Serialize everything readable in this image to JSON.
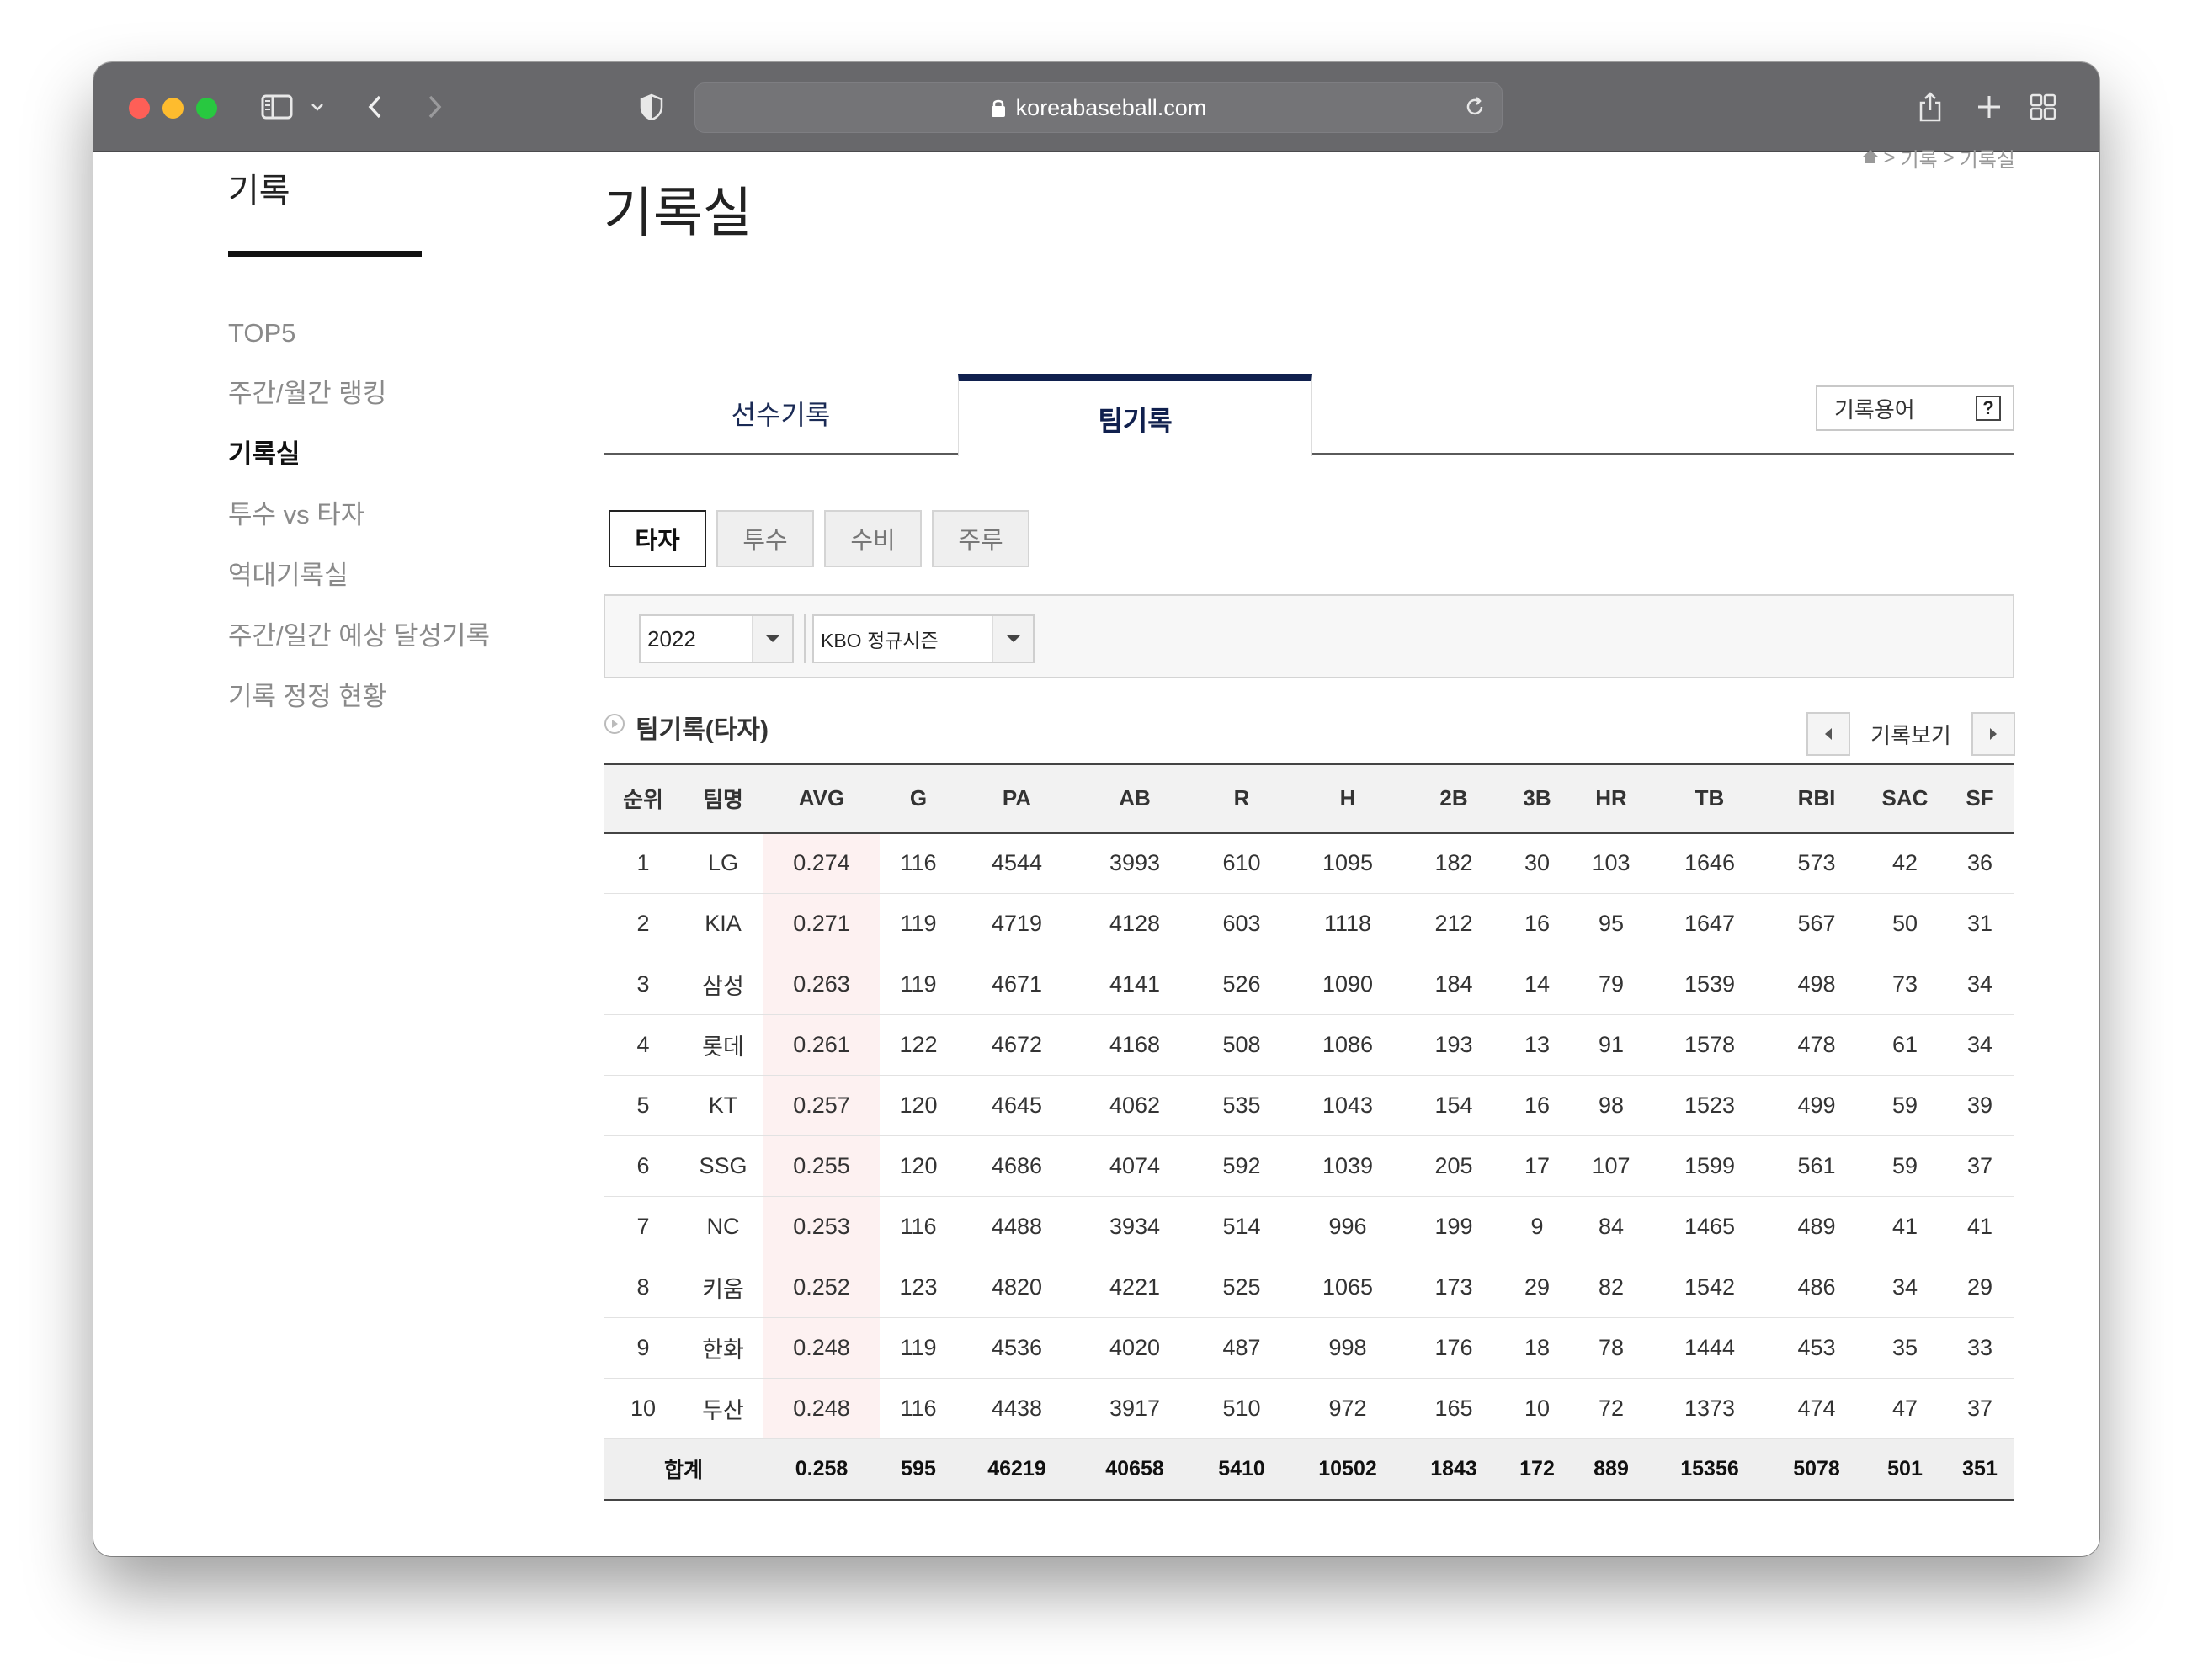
{
  "browser": {
    "url": "koreabaseball.com"
  },
  "sidebar": {
    "title": "기록",
    "items": [
      {
        "label": "TOP5",
        "active": false
      },
      {
        "label": "주간/월간 랭킹",
        "active": false
      },
      {
        "label": "기록실",
        "active": true
      },
      {
        "label": "투수 vs 타자",
        "active": false
      },
      {
        "label": "역대기록실",
        "active": false
      },
      {
        "label": "주간/일간 예상 달성기록",
        "active": false
      },
      {
        "label": "기록 정정 현황",
        "active": false
      }
    ]
  },
  "breadcrumb": {
    "items": [
      "기록",
      "기록실"
    ],
    "sep": ">"
  },
  "main": {
    "title": "기록실",
    "tabs": [
      {
        "label": "선수기록",
        "active": false
      },
      {
        "label": "팀기록",
        "active": true
      }
    ],
    "term_button": {
      "label": "기록용어",
      "q": "?"
    },
    "subtabs": [
      {
        "label": "타자",
        "active": true
      },
      {
        "label": "투수",
        "active": false
      },
      {
        "label": "수비",
        "active": false
      },
      {
        "label": "주루",
        "active": false
      }
    ],
    "filters": {
      "year": "2022",
      "season": "KBO 정규시즌"
    },
    "section_title": "팀기록(타자)",
    "nav_label": "기록보기"
  },
  "table": {
    "headers": [
      "순위",
      "팀명",
      "AVG",
      "G",
      "PA",
      "AB",
      "R",
      "H",
      "2B",
      "3B",
      "HR",
      "TB",
      "RBI",
      "SAC",
      "SF"
    ],
    "rows": [
      [
        "1",
        "LG",
        "0.274",
        "116",
        "4544",
        "3993",
        "610",
        "1095",
        "182",
        "30",
        "103",
        "1646",
        "573",
        "42",
        "36"
      ],
      [
        "2",
        "KIA",
        "0.271",
        "119",
        "4719",
        "4128",
        "603",
        "1118",
        "212",
        "16",
        "95",
        "1647",
        "567",
        "50",
        "31"
      ],
      [
        "3",
        "삼성",
        "0.263",
        "119",
        "4671",
        "4141",
        "526",
        "1090",
        "184",
        "14",
        "79",
        "1539",
        "498",
        "73",
        "34"
      ],
      [
        "4",
        "롯데",
        "0.261",
        "122",
        "4672",
        "4168",
        "508",
        "1086",
        "193",
        "13",
        "91",
        "1578",
        "478",
        "61",
        "34"
      ],
      [
        "5",
        "KT",
        "0.257",
        "120",
        "4645",
        "4062",
        "535",
        "1043",
        "154",
        "16",
        "98",
        "1523",
        "499",
        "59",
        "39"
      ],
      [
        "6",
        "SSG",
        "0.255",
        "120",
        "4686",
        "4074",
        "592",
        "1039",
        "205",
        "17",
        "107",
        "1599",
        "561",
        "59",
        "37"
      ],
      [
        "7",
        "NC",
        "0.253",
        "116",
        "4488",
        "3934",
        "514",
        "996",
        "199",
        "9",
        "84",
        "1465",
        "489",
        "41",
        "41"
      ],
      [
        "8",
        "키움",
        "0.252",
        "123",
        "4820",
        "4221",
        "525",
        "1065",
        "173",
        "29",
        "82",
        "1542",
        "486",
        "34",
        "29"
      ],
      [
        "9",
        "한화",
        "0.248",
        "119",
        "4536",
        "4020",
        "487",
        "998",
        "176",
        "18",
        "78",
        "1444",
        "453",
        "35",
        "33"
      ],
      [
        "10",
        "두산",
        "0.248",
        "116",
        "4438",
        "3917",
        "510",
        "972",
        "165",
        "10",
        "72",
        "1373",
        "474",
        "47",
        "37"
      ]
    ],
    "total": [
      "합계",
      "0.258",
      "595",
      "46219",
      "40658",
      "5410",
      "10502",
      "1843",
      "172",
      "889",
      "15356",
      "5078",
      "501",
      "351"
    ]
  },
  "colors": {
    "accent": "#10204e",
    "avg_highlight": "#fdf1f1",
    "titlebar": "#68686b"
  }
}
